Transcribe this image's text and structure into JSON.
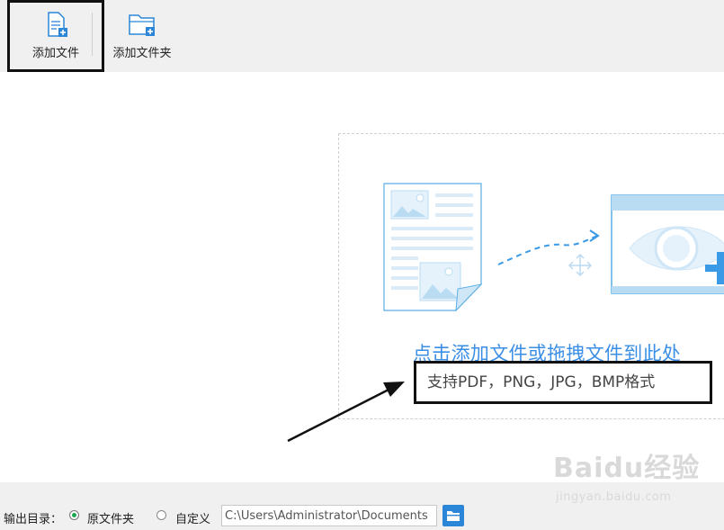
{
  "toolbar": {
    "add_file_label": "添加文件",
    "add_folder_label": "添加文件夹"
  },
  "drop_zone": {
    "title": "点击添加文件或拖拽文件到此处",
    "formats": "支持PDF，PNG，JPG，BMP格式"
  },
  "footer": {
    "output_label": "输出目录：",
    "option_original": "原文件夹",
    "option_custom": "自定义",
    "path_value": "C:\\Users\\Administrator\\Documents",
    "selected_option": "原文件夹"
  },
  "watermark": {
    "brand": "Baidu经验",
    "url": "jingyan.baidu.com"
  },
  "colors": {
    "accent": "#3a8ee6",
    "selected_radio": "#1aa84f"
  },
  "icons": [
    "add-file-icon",
    "add-folder-icon",
    "document-image-icon",
    "eye-image-icon",
    "move-icon",
    "folder-browse-icon"
  ]
}
